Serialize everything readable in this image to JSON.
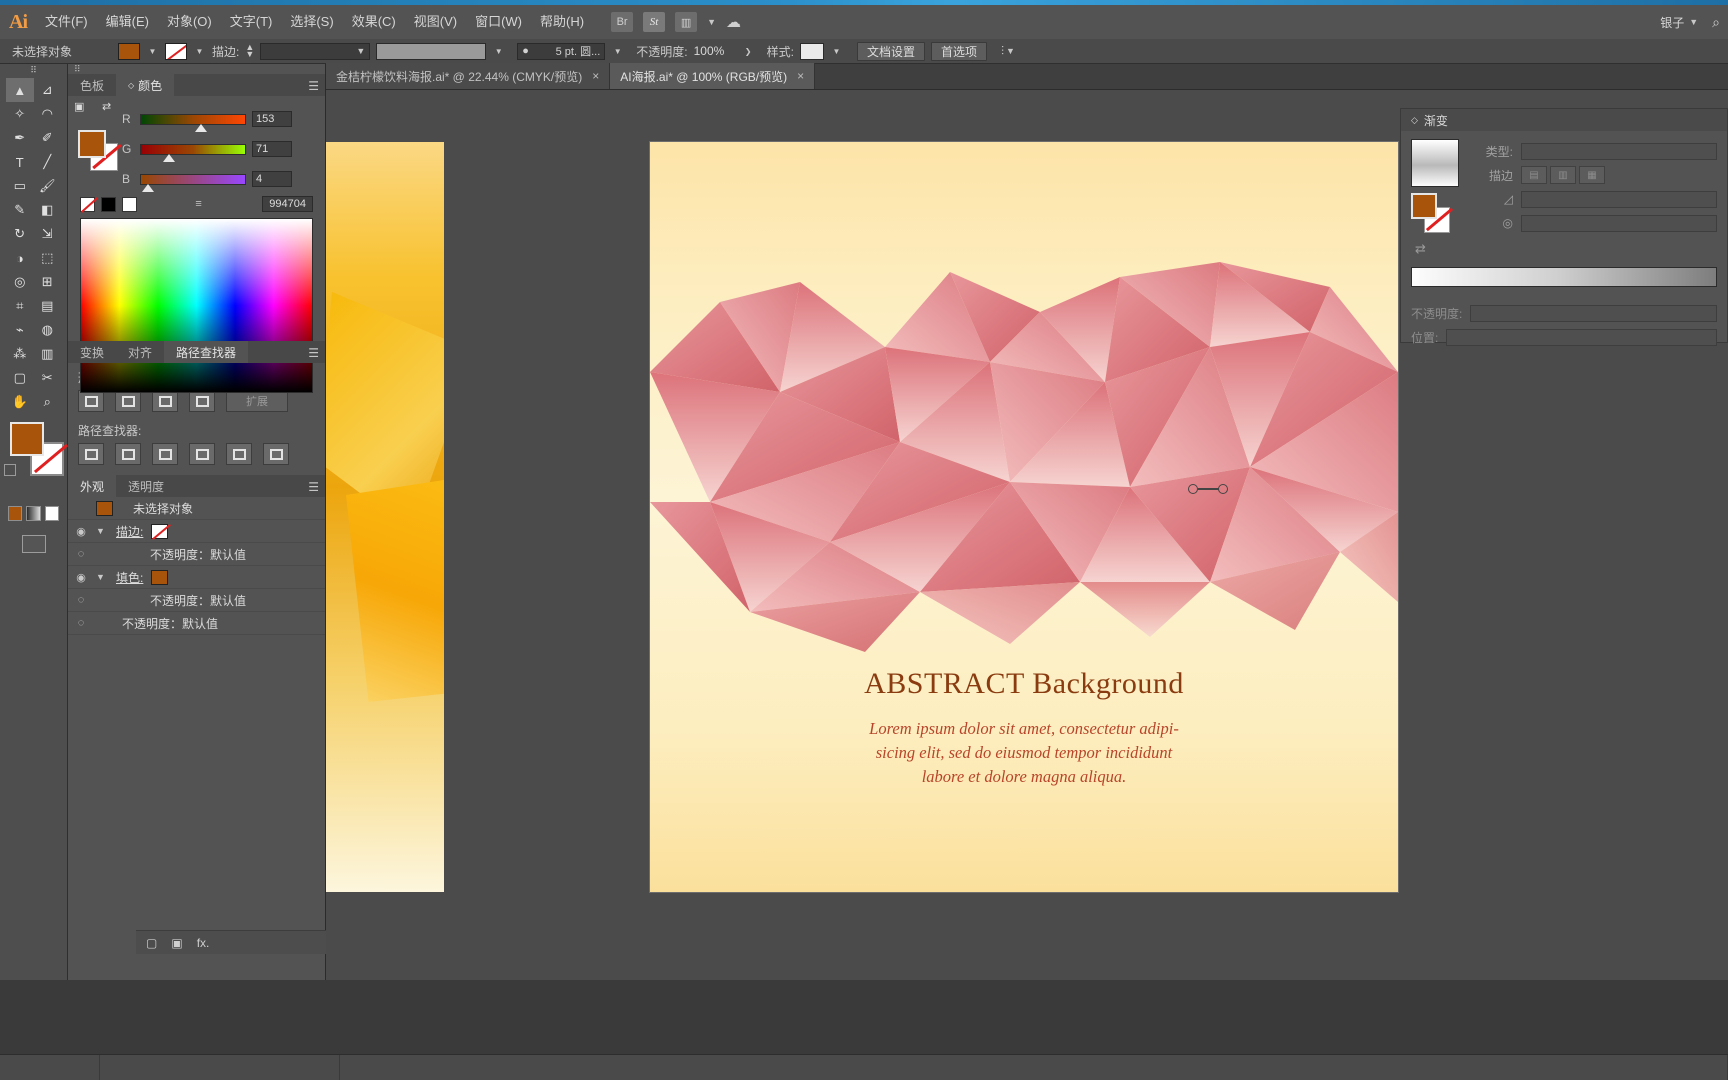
{
  "app": {
    "name": "Ai",
    "logo_color": "#f29c45"
  },
  "menubar": {
    "items": [
      "文件(F)",
      "编辑(E)",
      "对象(O)",
      "文字(T)",
      "选择(S)",
      "效果(C)",
      "视图(V)",
      "窗口(W)",
      "帮助(H)"
    ],
    "right_icons": [
      "bridge-icon",
      "stock-icon",
      "arrange-documents-icon",
      "chevron-down-icon",
      "cloud-sync-icon"
    ],
    "user_label": "银子",
    "search_icon": "search-icon"
  },
  "controlbar": {
    "selection_status": "未选择对象",
    "fill_swatch_color": "#a8540a",
    "stroke_swatch": "none",
    "stroke_label": "描边:",
    "stroke_weight_value": "",
    "stroke_profile": "5 pt. 圆...",
    "opacity_label": "不透明度:",
    "opacity_value": "100%",
    "style_label": "样式:",
    "doc_setup_button": "文档设置",
    "preferences_button": "首选项",
    "align_icon": "align-icon"
  },
  "tabs": [
    {
      "title": "金桔柠檬饮料海报.ai*  @ 22.44% (CMYK/预览)",
      "active": false,
      "close": "×"
    },
    {
      "title": "AI海报.ai*  @ 100% (RGB/预览)",
      "active": true,
      "close": "×"
    }
  ],
  "toolbar": {
    "tools": [
      "selection-tool",
      "direct-selection-tool",
      "magic-wand-tool",
      "lasso-tool",
      "pen-tool",
      "curvature-tool",
      "type-tool",
      "line-segment-tool",
      "rectangle-tool",
      "paintbrush-tool",
      "pencil-tool",
      "eraser-tool",
      "rotate-tool",
      "scale-tool",
      "width-tool",
      "free-transform-tool",
      "shape-builder-tool",
      "perspective-grid-tool",
      "mesh-tool",
      "gradient-tool",
      "eyedropper-tool",
      "blend-tool",
      "symbol-sprayer-tool",
      "column-graph-tool",
      "artboard-tool",
      "slice-tool",
      "hand-tool",
      "zoom-tool"
    ],
    "fill_color": "#a8540a",
    "stroke_color": "none",
    "screen_mode": "screen-mode-button"
  },
  "color_panel": {
    "tabs": [
      {
        "label": "色板",
        "active": false
      },
      {
        "label": "颜色",
        "active": true
      }
    ],
    "menu_icon": "panel-menu-icon",
    "channels": [
      {
        "label": "R",
        "value": "153"
      },
      {
        "label": "G",
        "value": "71"
      },
      {
        "label": "B",
        "value": "4"
      }
    ],
    "hex": "994704",
    "hex_prefix": "≡",
    "quick_swatches": [
      "none",
      "black",
      "white"
    ],
    "fill_color": "#a8540a"
  },
  "pathfinder_panel": {
    "tabs": [
      {
        "label": "变换",
        "active": false
      },
      {
        "label": "对齐",
        "active": false
      },
      {
        "label": "路径查找器",
        "active": true
      }
    ],
    "shape_modes_label": "形状模式:",
    "shape_modes": [
      "unite-icon",
      "minus-front-icon",
      "intersect-icon",
      "exclude-icon"
    ],
    "expand_button": "扩展",
    "pathfinders_label": "路径查找器:",
    "pathfinders": [
      "divide-icon",
      "trim-icon",
      "merge-icon",
      "crop-icon",
      "outline-icon",
      "minus-back-icon"
    ]
  },
  "appearance_panel": {
    "tabs": [
      {
        "label": "外观",
        "active": true
      },
      {
        "label": "透明度",
        "active": false
      }
    ],
    "rows": [
      {
        "indent": 0,
        "eye": false,
        "chevron": false,
        "swatch": "fill",
        "label": "未选择对象"
      },
      {
        "indent": 0,
        "eye": true,
        "chevron": true,
        "swatch": "none",
        "label": "描边:"
      },
      {
        "indent": 1,
        "eye": true,
        "chevron": false,
        "swatch": null,
        "label": "不透明度：默认值"
      },
      {
        "indent": 0,
        "eye": true,
        "chevron": true,
        "swatch": "fill",
        "label": "填色:"
      },
      {
        "indent": 1,
        "eye": true,
        "chevron": false,
        "swatch": null,
        "label": "不透明度：默认值"
      },
      {
        "indent": 1,
        "eye": true,
        "chevron": false,
        "swatch": null,
        "label": "不透明度：默认值"
      }
    ],
    "footer_icons": [
      "add-stroke-icon",
      "add-fill-icon",
      "add-effect-icon",
      "clear-appearance-icon",
      "duplicate-item-icon",
      "delete-item-icon"
    ],
    "fx_label": "fx."
  },
  "gradient_panel": {
    "title": "渐变",
    "menu_icon": "panel-menu-icon",
    "type_label": "类型:",
    "type_value": "",
    "stroke_label": "描边",
    "stroke_buttons": [
      "stroke-within-icon",
      "stroke-center-icon",
      "stroke-along-icon"
    ],
    "angle_label": "角度",
    "angle_value": "",
    "aspect_label": "长宽比",
    "aspect_value": "",
    "reverse_icon": "reverse-gradient-icon",
    "opacity_label": "不透明度:",
    "opacity_value": "",
    "location_label": "位置:",
    "location_value": "",
    "fill_color": "#a8540a"
  },
  "artwork": {
    "title": "ABSTRACT Background",
    "body_lines": [
      "Lorem ipsum dolor sit amet, consectetur adipi-",
      "sicing elit, sed do eiusmod tempor incididunt",
      "labore et dolore magna aliqua."
    ],
    "title_color": "#8a3c10",
    "body_color": "#b8442a",
    "bg_top_color": "#fde4a8",
    "poly_color": "#dd6f76",
    "left_art_color": "#f7b808"
  }
}
